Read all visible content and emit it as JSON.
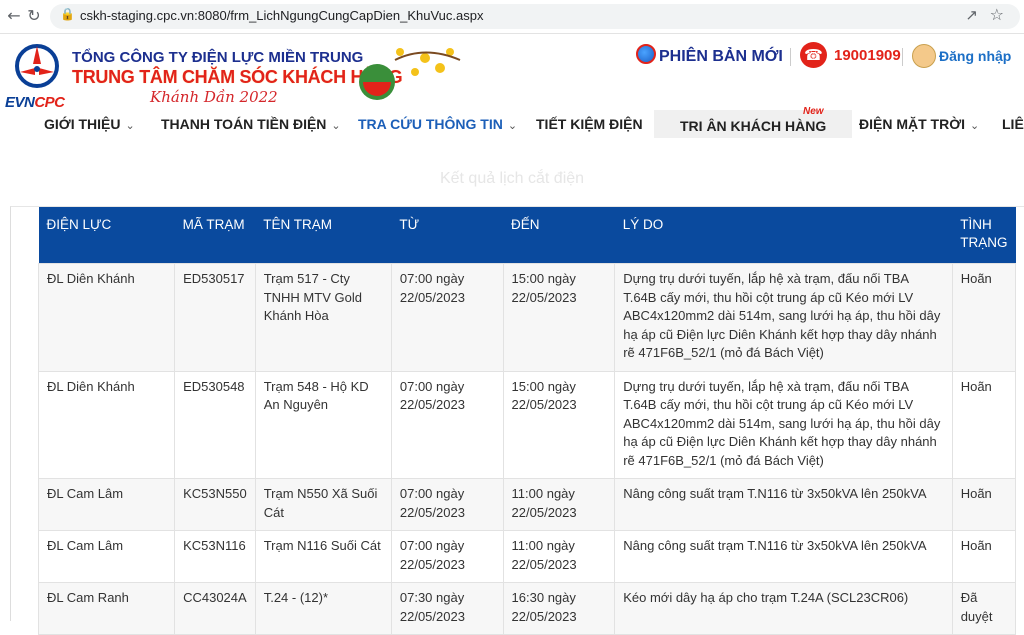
{
  "browser": {
    "url": "cskh-staging.cpc.vn:8080/frm_LichNgungCungCapDien_KhuVuc.aspx"
  },
  "header": {
    "brand": "EVN",
    "brand_suffix": "CPC",
    "org_top": "TỔNG CÔNG TY ĐIỆN LỰC MIỀN TRUNG",
    "org_main": "TRUNG TÂM CHĂM SÓC KHÁCH HÀNG",
    "org_year": "Khánh Dần 2022",
    "new_version": "PHIÊN BẢN MỚI",
    "hotline": "19001909",
    "login": "Đăng nhập"
  },
  "nav": {
    "items": [
      {
        "label": "GIỚI THIỆU"
      },
      {
        "label": "THANH TOÁN TIỀN ĐIỆN"
      },
      {
        "label": "TRA CỨU THÔNG TIN"
      },
      {
        "label": "TIẾT KIỆM ĐIỆN"
      },
      {
        "label": "TRI ÂN KHÁCH HÀNG"
      },
      {
        "label": "ĐIỆN MẶT TRỜI"
      },
      {
        "label": "LIÊ"
      }
    ],
    "new_badge": "New"
  },
  "page": {
    "title": "Kết quả lịch cắt điện"
  },
  "table": {
    "headers": [
      "ĐIỆN LỰC",
      "MÃ TRẠM",
      "TÊN TRẠM",
      "TỪ",
      "ĐẾN",
      "LÝ DO",
      "TÌNH TRẠNG"
    ],
    "rows": [
      [
        "ĐL Diên Khánh",
        "ED530517",
        "Trạm 517 - Cty TNHH MTV Gold Khánh Hòa",
        "07:00 ngày 22/05/2023",
        "15:00 ngày 22/05/2023",
        "Dựng trụ dưới tuyến, lắp hệ xà trạm, đấu nối TBA T.64B cấy mới, thu hồi cột trung áp cũ Kéo mới LV ABC4x120mm2 dài 514m, sang lưới hạ áp, thu hồi dây hạ áp cũ Điện lực Diên Khánh kết hợp thay dây nhánh rẽ 471F6B_52/1 (mỏ đá Bách Việt)",
        "Hoãn"
      ],
      [
        "ĐL Diên Khánh",
        "ED530548",
        "Trạm 548 - Hộ KD An Nguyên",
        "07:00 ngày 22/05/2023",
        "15:00 ngày 22/05/2023",
        "Dựng trụ dưới tuyến, lắp hệ xà trạm, đấu nối TBA T.64B cấy mới, thu hồi cột trung áp cũ Kéo mới LV ABC4x120mm2 dài 514m, sang lưới hạ áp, thu hồi dây hạ áp cũ Điện lực Diên Khánh kết hợp thay dây nhánh rẽ 471F6B_52/1 (mỏ đá Bách Việt)",
        "Hoãn"
      ],
      [
        "ĐL Cam Lâm",
        "KC53N550",
        "Trạm N550 Xã Suối Cát",
        "07:00 ngày 22/05/2023",
        "11:00 ngày 22/05/2023",
        "Nâng công suất trạm T.N116 từ 3x50kVA lên 250kVA",
        "Hoãn"
      ],
      [
        "ĐL Cam Lâm",
        "KC53N116",
        "Trạm N116 Suối Cát",
        "07:00 ngày 22/05/2023",
        "11:00 ngày 22/05/2023",
        "Nâng công suất trạm T.N116 từ 3x50kVA lên 250kVA",
        "Hoãn"
      ],
      [
        "ĐL Cam Ranh",
        "CC43024A",
        "T.24 - (12)*",
        "07:30 ngày 22/05/2023",
        "16:30 ngày 22/05/2023",
        "Kéo mới dây hạ áp cho trạm T.24A (SCL23CR06)",
        "Đã duyệt"
      ]
    ]
  }
}
